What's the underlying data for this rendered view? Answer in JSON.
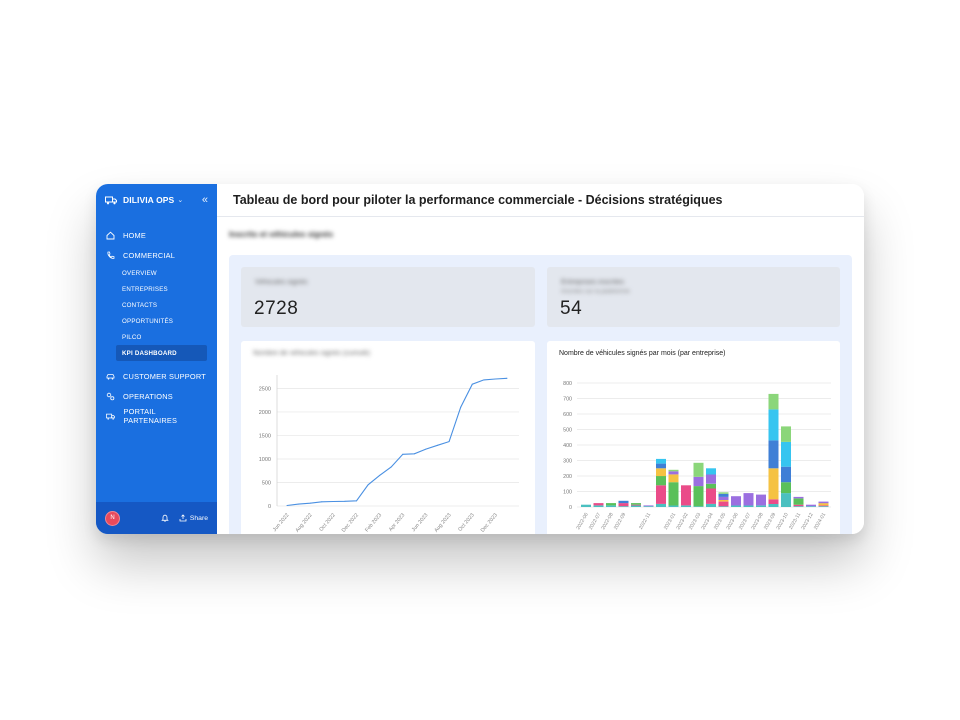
{
  "app": {
    "brand": "DILIVIA OPS",
    "page_title": "Tableau de bord pour piloter la performance commerciale - Décisions stratégiques"
  },
  "sidebar": {
    "items": [
      {
        "label": "HOME",
        "icon": "home-icon"
      },
      {
        "label": "COMMERCIAL",
        "icon": "phone-icon",
        "expanded": true,
        "children": [
          {
            "label": "OVERVIEW"
          },
          {
            "label": "ENTREPRISES"
          },
          {
            "label": "CONTACTS"
          },
          {
            "label": "OPPORTUNITÉS"
          },
          {
            "label": "PILCO"
          },
          {
            "label": "KPI DASHBOARD",
            "active": true
          }
        ]
      },
      {
        "label": "CUSTOMER SUPPORT",
        "icon": "car-icon"
      },
      {
        "label": "OPERATIONS",
        "icon": "cogs-icon"
      },
      {
        "label": "PORTAIL PARTENAIRES",
        "icon": "truck-icon"
      }
    ],
    "footer": {
      "avatar_letter": "N",
      "share_label": "Share"
    }
  },
  "dashboard": {
    "section_title": "Inscrits et véhicules signés",
    "stats": [
      {
        "label": "Véhicules signés",
        "value": "2728"
      },
      {
        "label": "Entreprises inscrites",
        "sub": "Inscrites sur la plateforme",
        "value": "54"
      }
    ],
    "colors": {
      "accent": "#1a6fe0",
      "line": "#4a90e2"
    }
  },
  "chart_data": [
    {
      "type": "line",
      "title": "Nombre de véhicules signés (cumulé)",
      "x_ticks": [
        "Jun 2022",
        "Aug 2022",
        "Oct 2022",
        "Dec 2022",
        "Feb 2023",
        "Apr 2023",
        "Jun 2023",
        "Aug 2023",
        "Oct 2023",
        "Dec 2023"
      ],
      "x": [
        "Jun 2022",
        "Jul 2022",
        "Aug 2022",
        "Sep 2022",
        "Oct 2022",
        "Nov 2022",
        "Dec 2022",
        "Jan 2023",
        "Feb 2023",
        "Mar 2023",
        "Apr 2023",
        "May 2023",
        "Jun 2023",
        "Jul 2023",
        "Aug 2023",
        "Sep 2023",
        "Oct 2023",
        "Nov 2023",
        "Dec 2023",
        "Jan 2024"
      ],
      "values": [
        10,
        40,
        60,
        90,
        95,
        100,
        110,
        450,
        650,
        830,
        1100,
        1110,
        1210,
        1290,
        1370,
        2100,
        2590,
        2680,
        2700,
        2715
      ],
      "ylim": [
        0,
        2700
      ],
      "yticks": [
        0,
        500,
        1000,
        1500,
        2000,
        2500
      ],
      "grid": true
    },
    {
      "type": "bar",
      "stacked": true,
      "title": "Nombre de véhicules signés par mois (par entreprise)",
      "categories": [
        "2022-06",
        "2022-07",
        "2022-08",
        "2022-09",
        "2022-10",
        "2022-11",
        "2022-12",
        "2023-01",
        "2023-02",
        "2023-03",
        "2023-04",
        "2023-05",
        "2023-06",
        "2023-07",
        "2023-08",
        "2023-09",
        "2023-10",
        "2023-11",
        "2023-12",
        "2024-01"
      ],
      "tick_labels": [
        "2022-06",
        "2022-07",
        "2022-08",
        "2022-09",
        "2022-11",
        "2023-01",
        "2023-02",
        "2023-03",
        "2023-04",
        "2023-05",
        "2023-06",
        "2023-07",
        "2023-08",
        "2023-09",
        "2023-10",
        "2023-11",
        "2023-12",
        "2024-01"
      ],
      "segment_colors": [
        "#4bc0c0",
        "#ea4c89",
        "#5ac05a",
        "#f5c242",
        "#9b6fe0",
        "#3f7fd6",
        "#36c5f0",
        "#8bd67a"
      ],
      "series": [
        {
          "values": [
            15,
            10,
            10,
            5,
            10,
            5,
            20,
            10,
            10,
            5,
            20,
            5,
            10,
            10,
            10,
            20,
            90,
            5,
            5,
            5
          ]
        },
        {
          "values": [
            0,
            15,
            0,
            20,
            5,
            0,
            120,
            0,
            130,
            0,
            100,
            30,
            0,
            0,
            0,
            30,
            0,
            10,
            0,
            5
          ]
        },
        {
          "values": [
            0,
            0,
            15,
            0,
            10,
            0,
            60,
            150,
            0,
            130,
            30,
            0,
            0,
            0,
            0,
            0,
            70,
            40,
            0,
            0
          ]
        },
        {
          "values": [
            0,
            0,
            0,
            0,
            0,
            0,
            50,
            50,
            0,
            0,
            0,
            10,
            0,
            0,
            0,
            200,
            0,
            0,
            0,
            15
          ]
        },
        {
          "values": [
            0,
            0,
            0,
            0,
            0,
            5,
            0,
            20,
            0,
            60,
            60,
            20,
            60,
            80,
            70,
            0,
            0,
            10,
            10,
            10
          ]
        },
        {
          "values": [
            0,
            0,
            0,
            15,
            0,
            0,
            30,
            0,
            0,
            0,
            0,
            20,
            0,
            0,
            0,
            180,
            100,
            0,
            0,
            0
          ]
        },
        {
          "values": [
            0,
            0,
            0,
            0,
            0,
            0,
            30,
            0,
            0,
            0,
            40,
            0,
            0,
            0,
            0,
            200,
            160,
            0,
            0,
            0
          ]
        },
        {
          "values": [
            0,
            0,
            0,
            0,
            0,
            0,
            0,
            10,
            0,
            90,
            0,
            10,
            0,
            0,
            0,
            100,
            100,
            0,
            0,
            0
          ]
        }
      ],
      "ylim": [
        0,
        800
      ],
      "yticks": [
        0,
        100,
        200,
        300,
        400,
        500,
        600,
        700,
        800
      ],
      "grid": true
    }
  ]
}
